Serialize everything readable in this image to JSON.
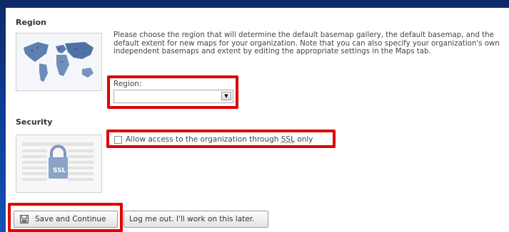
{
  "region": {
    "title": "Region",
    "description": "Please choose the region that will determine the default basemap gallery, the default basemap, and the default extent for new maps for your organization. Note that you can also specify your organization's own independent basemaps and extent by editing the appropriate settings in the Maps tab.",
    "select_label": "Region:",
    "select_value": ""
  },
  "security": {
    "title": "Security",
    "ssl_checkbox_label_prefix": "Allow access to the organization through ",
    "ssl_checkbox_label_abbr": "SSL",
    "ssl_checkbox_label_suffix": " only",
    "ssl_checked": false,
    "thumb_text": "SSL"
  },
  "buttons": {
    "save": "Save and Continue",
    "logout": "Log me out. I'll work on this later."
  },
  "colors": {
    "highlight": "#e00000",
    "background": "#0e3a8f"
  },
  "icons": {
    "region_thumb": "world-map-icon",
    "security_thumb": "lock-icon",
    "save": "floppy-disk-icon"
  }
}
